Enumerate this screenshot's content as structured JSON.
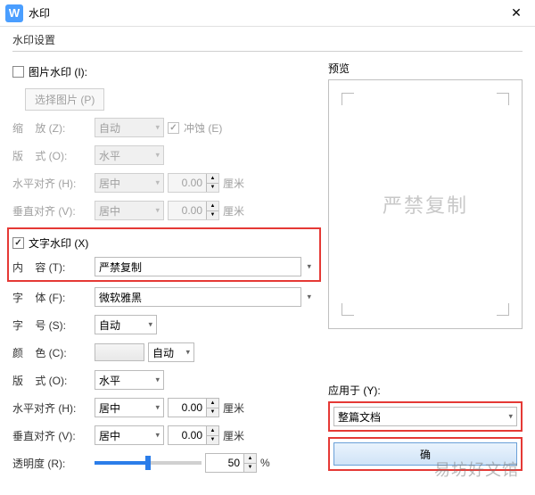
{
  "titlebar": {
    "logo": "W",
    "title": "水印"
  },
  "fieldset_label": "水印设置",
  "image_wm": {
    "checkbox_label": "图片水印 (I):",
    "select_btn": "选择图片 (P)",
    "scale_label": "缩    放 (Z):",
    "scale_value": "自动",
    "erosion_label": "冲蚀 (E)",
    "layout_label": "版    式 (O):",
    "layout_value": "水平",
    "halign_label": "水平对齐 (H):",
    "halign_value": "居中",
    "halign_num": "0.00",
    "valign_label": "垂直对齐 (V):",
    "valign_value": "居中",
    "valign_num": "0.00",
    "unit": "厘米"
  },
  "text_wm": {
    "checkbox_label": "文字水印 (X)",
    "content_label": "内    容 (T):",
    "content_value": "严禁复制",
    "font_label": "字    体 (F):",
    "font_value": "微软雅黑",
    "size_label": "字    号 (S):",
    "size_value": "自动",
    "color_label": "颜    色 (C):",
    "color_value": "自动",
    "layout_label": "版    式 (O):",
    "layout_value": "水平",
    "halign_label": "水平对齐 (H):",
    "halign_value": "居中",
    "halign_num": "0.00",
    "valign_label": "垂直对齐 (V):",
    "valign_value": "居中",
    "valign_num": "0.00",
    "unit": "厘米",
    "opacity_label": "透明度 (R):",
    "opacity_value": "50",
    "opacity_unit": "%"
  },
  "preview": {
    "label": "预览",
    "text": "严禁复制"
  },
  "apply": {
    "label": "应用于 (Y):",
    "value": "整篇文档"
  },
  "ok_btn": "确",
  "site_watermark": "易坊好文馆"
}
